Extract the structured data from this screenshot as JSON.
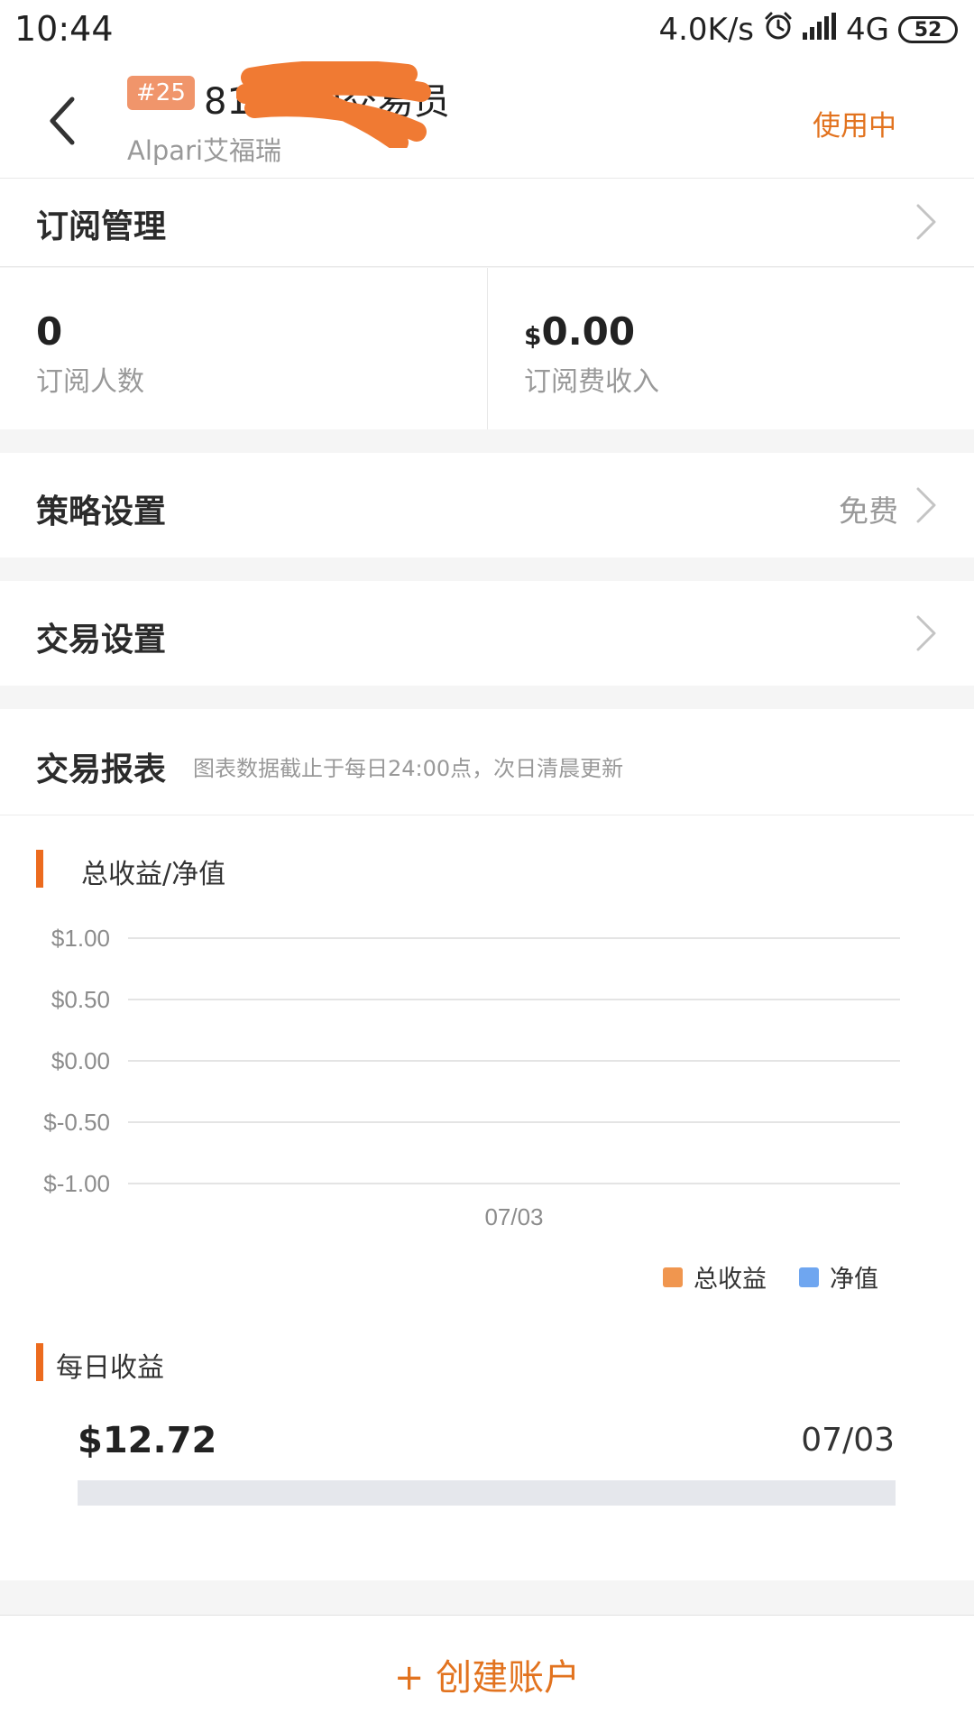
{
  "status_bar": {
    "time": "10:44",
    "network_speed": "4.0K/s",
    "network_type": "4G",
    "battery": "52"
  },
  "header": {
    "badge": "#25",
    "account_title": "810000交易员",
    "broker": "Alpari艾福瑞",
    "status": "使用中"
  },
  "subscription": {
    "title": "订阅管理",
    "subscribers_value": "0",
    "subscribers_label": "订阅人数",
    "income_currency": "$",
    "income_value": "0.00",
    "income_label": "订阅费收入"
  },
  "strategy": {
    "title": "策略设置",
    "value": "免费"
  },
  "trade_settings": {
    "title": "交易设置"
  },
  "report": {
    "title": "交易报表",
    "hint": "图表数据截止于每日24:00点，次日清晨更新"
  },
  "profit_chart": {
    "title": "总收益/净值",
    "legend": [
      "总收益",
      "净值"
    ]
  },
  "daily": {
    "title": "每日收益",
    "amount": "$12.72",
    "date": "07/03"
  },
  "create_button": {
    "label": "+ 创建账户"
  },
  "colors": {
    "accent": "#e2731f",
    "total_profit_series": "#f0964f",
    "net_value_series": "#6fa6f0"
  },
  "chart_data": [
    {
      "type": "line",
      "title": "总收益/净值",
      "xlabel": "",
      "ylabel": "",
      "x": [
        "07/03"
      ],
      "y_ticks": [
        "$1.00",
        "$0.50",
        "$0.00",
        "$-0.50",
        "$-1.00"
      ],
      "ylim": [
        -1,
        1
      ],
      "grid": true,
      "legend_position": "bottom-right",
      "series": [
        {
          "name": "总收益",
          "color": "#f0964f",
          "values": []
        },
        {
          "name": "净值",
          "color": "#6fa6f0",
          "values": []
        }
      ]
    },
    {
      "type": "bar",
      "title": "每日收益",
      "orientation": "horizontal",
      "categories": [
        "07/03"
      ],
      "values": [
        12.72
      ],
      "value_labels": [
        "$12.72"
      ]
    }
  ]
}
